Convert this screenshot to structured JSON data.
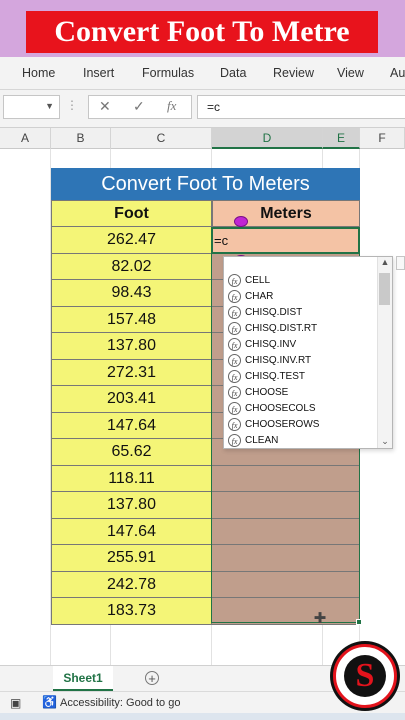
{
  "banner": {
    "title": "Convert Foot To Metre"
  },
  "ribbon": {
    "tabs": [
      "Home",
      "Insert",
      "Formulas",
      "Data",
      "Review",
      "View",
      "Au"
    ]
  },
  "formula_bar": {
    "name_box": "",
    "cancel_icon": "✕",
    "enter_icon": "✓",
    "fx_label": "fx",
    "content": "=c"
  },
  "columns": [
    "A",
    "B",
    "C",
    "D",
    "E",
    "F"
  ],
  "table": {
    "title": "Convert Foot To Meters",
    "header_foot": "Foot",
    "header_meters": "Meters",
    "feet": [
      "262.47",
      "82.02",
      "98.43",
      "157.48",
      "137.80",
      "272.31",
      "203.41",
      "147.64",
      "65.62",
      "118.11",
      "137.80",
      "147.64",
      "255.91",
      "242.78",
      "183.73"
    ],
    "active_cell_text": "=c"
  },
  "autocomplete": {
    "items": [
      "CELL",
      "CHAR",
      "CHISQ.DIST",
      "CHISQ.DIST.RT",
      "CHISQ.INV",
      "CHISQ.INV.RT",
      "CHISQ.TEST",
      "CHOOSE",
      "CHOOSECOLS",
      "CHOOSEROWS",
      "CLEAN"
    ],
    "icon": "fx"
  },
  "sheets": {
    "active": "Sheet1",
    "add_label": "+"
  },
  "status": {
    "accessibility": "Accessibility: Good to go"
  },
  "colors": {
    "accent_green": "#217346",
    "title_blue": "#2e75b6",
    "foot_yellow": "#f4f577",
    "meters_header": "#f4c3a5",
    "meters_fill": "#c09e8c",
    "banner_red": "#e8131c"
  }
}
